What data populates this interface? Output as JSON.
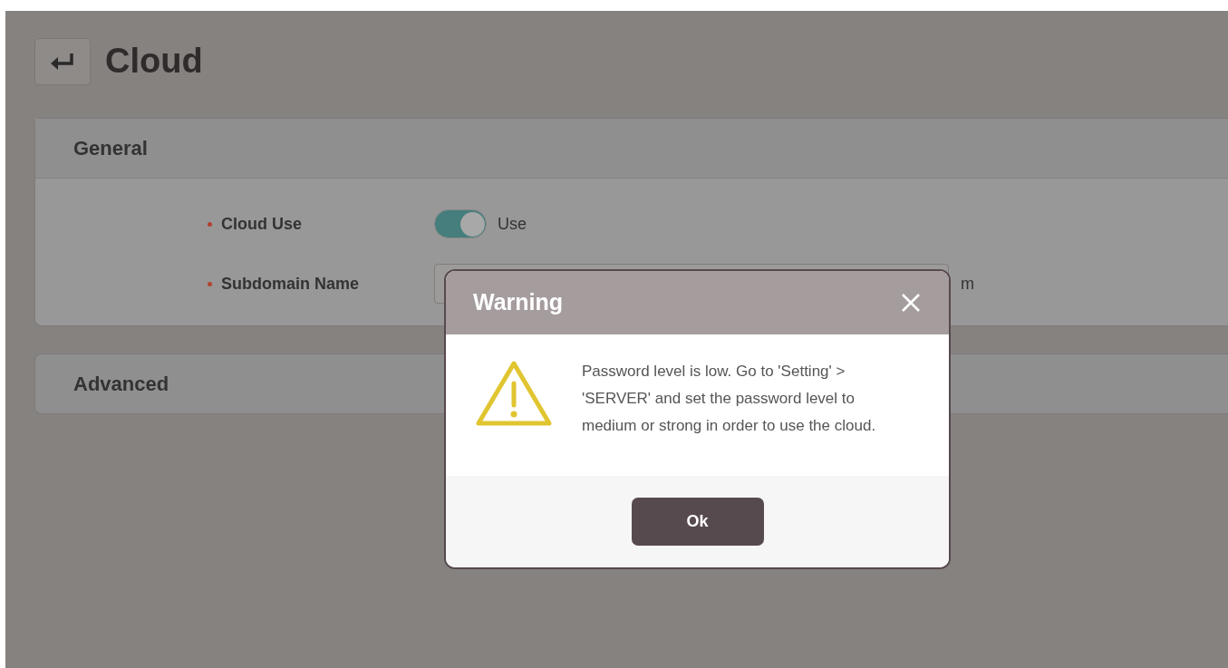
{
  "page": {
    "title": "Cloud"
  },
  "sections": [
    {
      "title": "General",
      "fields": [
        {
          "kind": "toggle",
          "label": "Cloud Use",
          "required": true,
          "on": true,
          "text": "Use"
        },
        {
          "kind": "text",
          "label": "Subdomain Name",
          "required": true,
          "suffix": "m"
        }
      ]
    },
    {
      "title": "Advanced"
    }
  ],
  "dialog": {
    "title": "Warning",
    "message": "Password level is low. Go to 'Setting' > 'SERVER' and set the password level to medium or strong in order to use the cloud.",
    "button": "Ok"
  }
}
